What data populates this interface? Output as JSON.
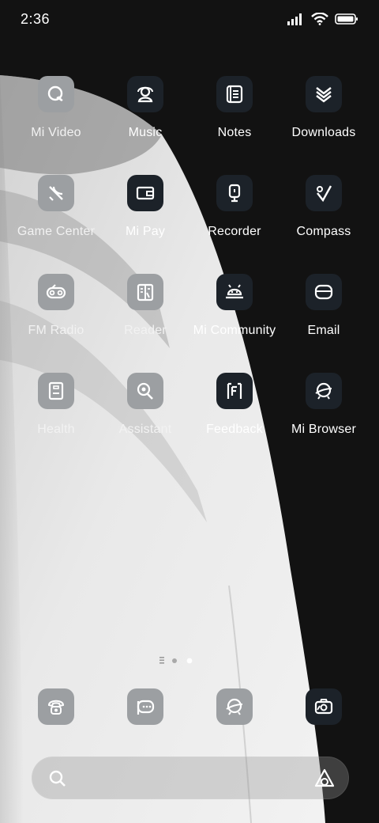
{
  "status_bar": {
    "time": "2:36",
    "icons": [
      "signal-icon",
      "wifi-icon",
      "battery-icon"
    ]
  },
  "apps": [
    {
      "label": "Mi Video",
      "icon": "video-icon"
    },
    {
      "label": "Music",
      "icon": "music-icon"
    },
    {
      "label": "Notes",
      "icon": "notes-icon"
    },
    {
      "label": "Downloads",
      "icon": "downloads-icon"
    },
    {
      "label": "Game Center",
      "icon": "game-center-icon"
    },
    {
      "label": "Mi Pay",
      "icon": "wallet-icon"
    },
    {
      "label": "Recorder",
      "icon": "recorder-icon"
    },
    {
      "label": "Compass",
      "icon": "compass-icon"
    },
    {
      "label": "FM Radio",
      "icon": "radio-icon"
    },
    {
      "label": "Reader",
      "icon": "reader-icon"
    },
    {
      "label": "Mi Community",
      "icon": "community-icon"
    },
    {
      "label": "Email",
      "icon": "email-icon"
    },
    {
      "label": "Health",
      "icon": "health-icon"
    },
    {
      "label": "Assistant",
      "icon": "assistant-icon"
    },
    {
      "label": "Feedback",
      "icon": "feedback-icon"
    },
    {
      "label": "Mi Browser",
      "icon": "browser-icon"
    }
  ],
  "page_indicator": {
    "pages": 3,
    "current": 3
  },
  "dock": [
    {
      "icon": "phone-icon"
    },
    {
      "icon": "messages-icon"
    },
    {
      "icon": "browser-icon"
    },
    {
      "icon": "camera-icon"
    }
  ],
  "search_bar": {
    "icons": [
      "search-icon",
      "assistant-triangle-icon"
    ]
  },
  "colors": {
    "background": "#121212",
    "icon_tile_dark": "#1c2229",
    "icon_tile_light": "#9c9fa2"
  }
}
